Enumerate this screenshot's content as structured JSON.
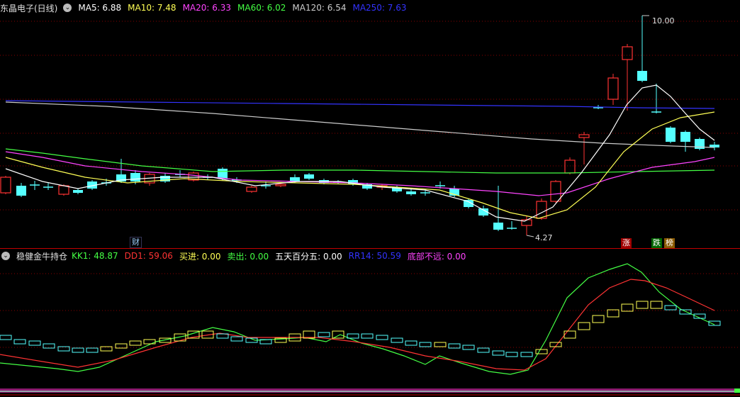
{
  "top": {
    "title": "东晶电子(日线)",
    "indicators": [
      {
        "label": "MA5: 6.88",
        "color": "#ffffff"
      },
      {
        "label": "MA10: 7.48",
        "color": "#ffff55"
      },
      {
        "label": "MA20: 6.33",
        "color": "#ff44ff"
      },
      {
        "label": "MA60: 6.02",
        "color": "#44ff44"
      },
      {
        "label": "MA120: 6.54",
        "color": "#cccccc"
      },
      {
        "label": "MA250: 7.63",
        "color": "#3333ff"
      }
    ],
    "high_label": "10.00",
    "low_label": "4.27",
    "badges": {
      "cai": "财",
      "zhang": "涨",
      "die": "跌",
      "bang": "榜"
    }
  },
  "bottom": {
    "title": "稳健金牛持仓",
    "indicators": [
      {
        "label": "KK1: 48.87",
        "color": "#44ff44"
      },
      {
        "label": "DD1: 59.06",
        "color": "#ff3333"
      },
      {
        "label": "买进: 0.00",
        "color": "#ffff55"
      },
      {
        "label": "卖出: 0.00",
        "color": "#44ff44"
      },
      {
        "label": "五天百分五: 0.00",
        "color": "#ffffff"
      },
      {
        "label": "RR14: 50.59",
        "color": "#3333ff"
      },
      {
        "label": "底部不远: 0.00",
        "color": "#ff44ff"
      }
    ]
  },
  "colors": {
    "up": "#ff3333",
    "down": "#55ffff",
    "grid": "#8a0000",
    "border": "#c00000"
  }
}
